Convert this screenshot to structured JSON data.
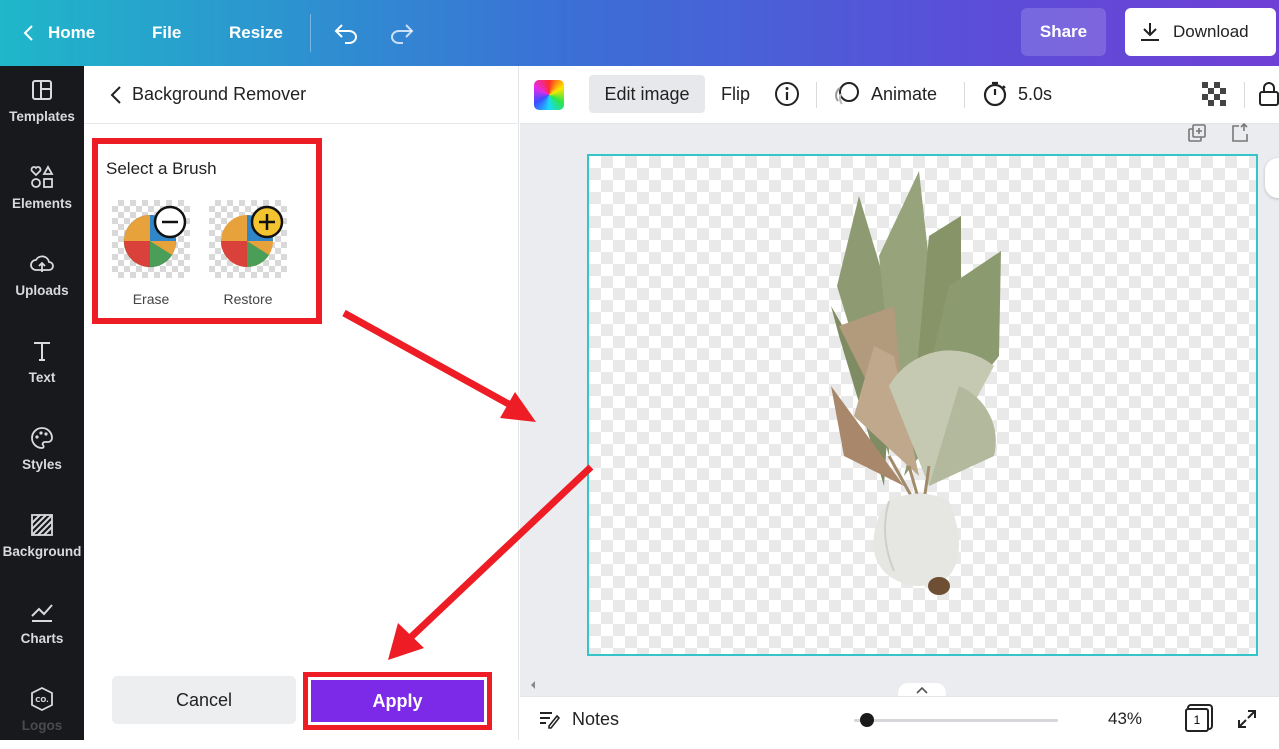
{
  "topbar": {
    "home_label": "Home",
    "file_label": "File",
    "resize_label": "Resize",
    "share_label": "Share",
    "download_label": "Download"
  },
  "rail": {
    "items": [
      {
        "label": "Templates",
        "icon": "templates-icon"
      },
      {
        "label": "Elements",
        "icon": "elements-icon"
      },
      {
        "label": "Uploads",
        "icon": "uploads-icon"
      },
      {
        "label": "Text",
        "icon": "text-icon"
      },
      {
        "label": "Styles",
        "icon": "styles-icon"
      },
      {
        "label": "Background",
        "icon": "background-icon"
      },
      {
        "label": "Charts",
        "icon": "charts-icon"
      },
      {
        "label": "Logos",
        "icon": "logos-icon"
      }
    ]
  },
  "panel": {
    "title": "Background Remover",
    "brush_title": "Select a Brush",
    "brushes": [
      {
        "label": "Erase",
        "icon": "minus-circle-icon"
      },
      {
        "label": "Restore",
        "icon": "plus-circle-icon"
      }
    ],
    "cancel_label": "Cancel",
    "apply_label": "Apply"
  },
  "toolbar": {
    "edit_image_label": "Edit image",
    "flip_label": "Flip",
    "animate_label": "Animate",
    "duration_label": "5.0s"
  },
  "bottombar": {
    "notes_label": "Notes",
    "zoom_label": "43%",
    "zoom_level": 0.43,
    "page_count": "1"
  },
  "colors": {
    "accent_purple": "#7d2ae8",
    "annotation_red": "#ee1c24",
    "canvas_border": "#35c4c9"
  }
}
